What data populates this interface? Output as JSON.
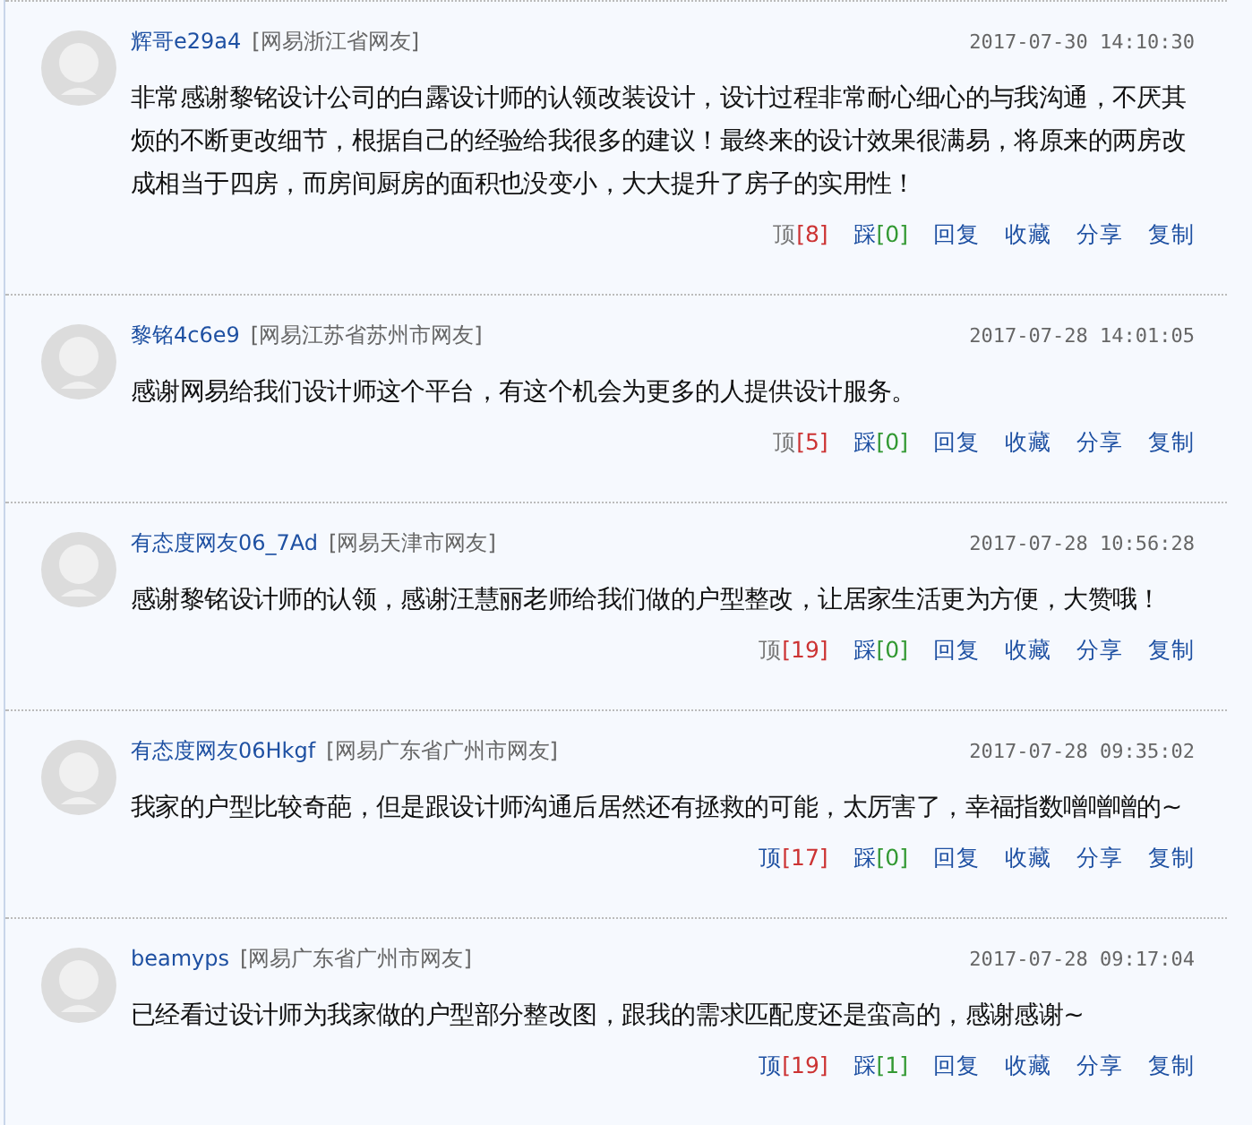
{
  "comments": [
    {
      "user": "辉哥e29a4",
      "location": "[网易浙江省网友]",
      "time": "2017-07-30 14:10:30",
      "text": "非常感谢黎铭设计公司的白露设计师的认领改装设计，设计过程非常耐心细心的与我沟通，不厌其烦的不断更改细节，根据自己的经验给我很多的建议！最终来的设计效果很满易，将原来的两房改成相当于四房，而房间厨房的面积也没变小，大大提升了房子的实用性！",
      "up_label": "顶",
      "up_count": "[8]",
      "up_disabled": true,
      "down_label": "踩",
      "down_count": "[0]",
      "actions": [
        "回复",
        "收藏",
        "分享",
        "复制"
      ]
    },
    {
      "user": "黎铭4c6e9",
      "location": "[网易江苏省苏州市网友]",
      "time": "2017-07-28 14:01:05",
      "text": "感谢网易给我们设计师这个平台，有这个机会为更多的人提供设计服务。",
      "up_label": "顶",
      "up_count": "[5]",
      "up_disabled": true,
      "down_label": "踩",
      "down_count": "[0]",
      "actions": [
        "回复",
        "收藏",
        "分享",
        "复制"
      ]
    },
    {
      "user": "有态度网友06_7Ad",
      "location": "[网易天津市网友]",
      "time": "2017-07-28 10:56:28",
      "text": "感谢黎铭设计师的认领，感谢汪慧丽老师给我们做的户型整改，让居家生活更为方便，大赞哦！",
      "up_label": "顶",
      "up_count": "[19]",
      "up_disabled": true,
      "down_label": "踩",
      "down_count": "[0]",
      "actions": [
        "回复",
        "收藏",
        "分享",
        "复制"
      ]
    },
    {
      "user": "有态度网友06Hkgf",
      "location": "[网易广东省广州市网友]",
      "time": "2017-07-28 09:35:02",
      "text": "我家的户型比较奇葩，但是跟设计师沟通后居然还有拯救的可能，太厉害了，幸福指数噌噌噌的~",
      "up_label": "顶",
      "up_count": "[17]",
      "up_disabled": false,
      "down_label": "踩",
      "down_count": "[0]",
      "actions": [
        "回复",
        "收藏",
        "分享",
        "复制"
      ]
    },
    {
      "user": "beamyps",
      "location": "[网易广东省广州市网友]",
      "time": "2017-07-28 09:17:04",
      "text": "已经看过设计师为我家做的户型部分整改图，跟我的需求匹配度还是蛮高的，感谢感谢~",
      "up_label": "顶",
      "up_count": "[19]",
      "up_disabled": false,
      "down_label": "踩",
      "down_count": "[1]",
      "actions": [
        "回复",
        "收藏",
        "分享",
        "复制"
      ]
    }
  ]
}
